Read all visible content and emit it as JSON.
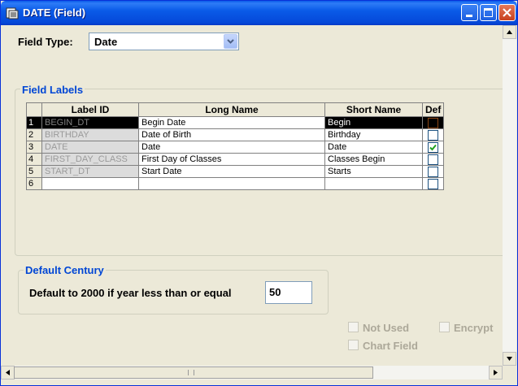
{
  "window": {
    "title": "DATE (Field)"
  },
  "field_type": {
    "label": "Field Type:",
    "value": "Date"
  },
  "field_labels": {
    "group_title": "Field Labels",
    "columns": [
      "Label ID",
      "Long Name",
      "Short Name",
      "Def"
    ],
    "rows": [
      {
        "num": "1",
        "label_id": "BEGIN_DT",
        "long_name": "Begin Date",
        "short_name": "Begin",
        "def": false
      },
      {
        "num": "2",
        "label_id": "BIRTHDAY",
        "long_name": "Date of Birth",
        "short_name": "Birthday",
        "def": false
      },
      {
        "num": "3",
        "label_id": "DATE",
        "long_name": "Date",
        "short_name": "Date",
        "def": true
      },
      {
        "num": "4",
        "label_id": "FIRST_DAY_CLASS",
        "long_name": "First Day of Classes",
        "short_name": "Classes Begin",
        "def": false
      },
      {
        "num": "5",
        "label_id": "START_DT",
        "long_name": "Start Date",
        "short_name": "Starts",
        "def": false
      },
      {
        "num": "6",
        "label_id": "",
        "long_name": "",
        "short_name": "",
        "def": false
      }
    ]
  },
  "default_century": {
    "group_title": "Default Century",
    "label": "Default to 2000 if year less than or equal",
    "value": "50"
  },
  "options": {
    "not_used": "Not Used",
    "encrypt": "Encrypt",
    "chart_field": "Chart Field"
  },
  "colors": {
    "titlebar": "#0A5BE8",
    "group_title": "#0046D5",
    "check_green": "#21A121"
  }
}
